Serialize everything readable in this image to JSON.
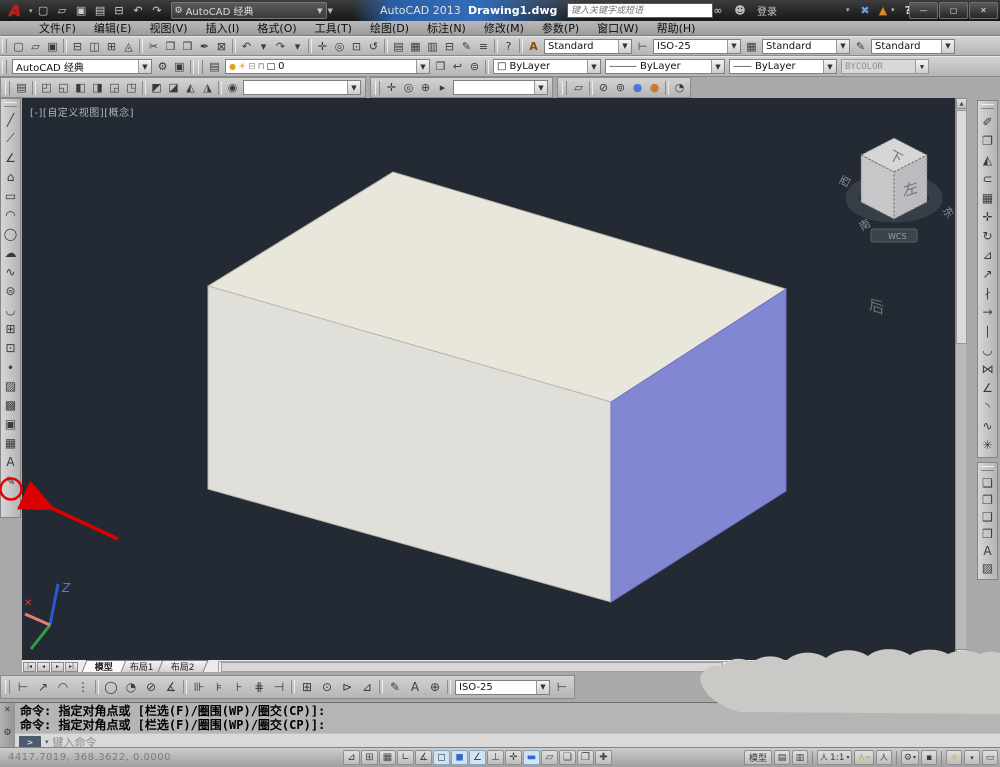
{
  "titlebar": {
    "logo_letter": "A",
    "quick_access": [
      {
        "name": "qnew-icon",
        "glyph": "▢"
      },
      {
        "name": "open-icon",
        "glyph": "▱"
      },
      {
        "name": "qsave-icon",
        "glyph": "▣"
      },
      {
        "name": "save-as-icon",
        "glyph": "▤"
      },
      {
        "name": "plot-icon",
        "glyph": "⊟"
      },
      {
        "name": "undo-icon",
        "glyph": "↶"
      },
      {
        "name": "redo-icon",
        "glyph": "↷"
      }
    ],
    "workspace_label": "AutoCAD 经典",
    "product": "AutoCAD 2013",
    "filename": "Drawing1.dwg",
    "search_placeholder": "键入关键字或短语",
    "search_icon": "∞",
    "signin_icon": "☻",
    "signin_label": "登录",
    "exchange_icon": "✖",
    "a360_icon": "▲",
    "help_icon": "?",
    "window_buttons": {
      "minimize": "—",
      "maximize": "▢",
      "close": "✕"
    }
  },
  "menubar": {
    "items": [
      {
        "name": "menu-file",
        "label": "文件(F)"
      },
      {
        "name": "menu-edit",
        "label": "编辑(E)"
      },
      {
        "name": "menu-view",
        "label": "视图(V)"
      },
      {
        "name": "menu-insert",
        "label": "插入(I)"
      },
      {
        "name": "menu-format",
        "label": "格式(O)"
      },
      {
        "name": "menu-tools",
        "label": "工具(T)"
      },
      {
        "name": "menu-draw",
        "label": "绘图(D)"
      },
      {
        "name": "menu-dimension",
        "label": "标注(N)"
      },
      {
        "name": "menu-modify",
        "label": "修改(M)"
      },
      {
        "name": "menu-parametric",
        "label": "参数(P)"
      },
      {
        "name": "menu-window",
        "label": "窗口(W)"
      },
      {
        "name": "menu-help",
        "label": "帮助(H)"
      }
    ]
  },
  "standard_toolbar": {
    "items": [
      {
        "name": "qnew-icon",
        "glyph": "▢"
      },
      {
        "name": "open-icon",
        "glyph": "▱"
      },
      {
        "name": "qsave-icon",
        "glyph": "▣"
      },
      {
        "sep": 1
      },
      {
        "name": "plot-icon",
        "glyph": "⊟"
      },
      {
        "name": "plot-preview-icon",
        "glyph": "◫"
      },
      {
        "name": "publish-icon",
        "glyph": "⊞"
      },
      {
        "name": "export-dwf-icon",
        "glyph": "◬"
      },
      {
        "sep": 1
      },
      {
        "name": "cut-icon",
        "glyph": "✂"
      },
      {
        "name": "copy-icon",
        "glyph": "❐"
      },
      {
        "name": "paste-icon",
        "glyph": "❒"
      },
      {
        "name": "match-properties-icon",
        "glyph": "✒"
      },
      {
        "name": "block-editor-icon",
        "glyph": "⊠"
      },
      {
        "sep": 1
      },
      {
        "name": "undo-icon",
        "glyph": "↶"
      },
      {
        "name": "undo-dropdown-icon",
        "glyph": "▾"
      },
      {
        "name": "redo-icon",
        "glyph": "↷"
      },
      {
        "name": "redo-dropdown-icon",
        "glyph": "▾"
      },
      {
        "sep": 1
      },
      {
        "name": "pan-icon",
        "glyph": "✛"
      },
      {
        "name": "zoom-realtime-icon",
        "glyph": "◎"
      },
      {
        "name": "zoom-window-icon",
        "glyph": "⊡"
      },
      {
        "name": "zoom-previous-icon",
        "glyph": "↺"
      },
      {
        "sep": 1
      },
      {
        "name": "properties-icon",
        "glyph": "▤"
      },
      {
        "name": "designcenter-icon",
        "glyph": "▦"
      },
      {
        "name": "tool-palettes-icon",
        "glyph": "▥"
      },
      {
        "name": "sheetset-manager-icon",
        "glyph": "⊟"
      },
      {
        "name": "markup-icon",
        "glyph": "✎"
      },
      {
        "name": "quickcalc-icon",
        "glyph": "≡"
      },
      {
        "sep": 1
      },
      {
        "name": "help-icon",
        "glyph": "?"
      }
    ],
    "text_style_icon": "A",
    "text_style": "Standard",
    "dim_style_icon": "⊢",
    "dim_style": "ISO-25",
    "table_style_icon": "▦",
    "table_style": "Standard",
    "mleader_style_icon": "✎",
    "mleader_style": "Standard"
  },
  "workspace_layers": {
    "workspace": "AutoCAD 经典",
    "gear_icon": "⚙",
    "workspace_settings_icon": "▣",
    "layer_properties_icon": "▤",
    "bulb_glyph": "●",
    "sun_glyph": "☀",
    "plot_glyph": "⊟",
    "lock_glyph": "⊓",
    "color_swatch_glyph": "□",
    "layer_name": "0",
    "tool_icons": [
      {
        "name": "make-current-layer-icon",
        "glyph": "❐"
      },
      {
        "name": "previous-layer-icon",
        "glyph": "↩"
      },
      {
        "name": "layer-states-icon",
        "glyph": "⊜"
      }
    ],
    "color_swatch": "□",
    "color": "ByLayer",
    "linetype_dash": "———",
    "linetype": "ByLayer",
    "lineweight_dash": "——",
    "lineweight": "ByLayer",
    "plot_style": "BYCOLOR"
  },
  "view_toolbar": {
    "view_items": [
      {
        "name": "named-views-icon",
        "glyph": "▤"
      },
      {
        "sep": 1
      },
      {
        "name": "top-view-icon",
        "glyph": "◰"
      },
      {
        "name": "bottom-view-icon",
        "glyph": "◱"
      },
      {
        "name": "left-view-icon",
        "glyph": "◧"
      },
      {
        "name": "right-view-icon",
        "glyph": "◨"
      },
      {
        "name": "front-view-icon",
        "glyph": "◲"
      },
      {
        "name": "back-view-icon",
        "glyph": "◳"
      },
      {
        "sep": 1
      },
      {
        "name": "sw-isometric-icon",
        "glyph": "◩"
      },
      {
        "name": "se-isometric-icon",
        "glyph": "◪"
      },
      {
        "name": "ne-isometric-icon",
        "glyph": "◭"
      },
      {
        "name": "nw-isometric-icon",
        "glyph": "◮"
      },
      {
        "sep": 1
      },
      {
        "name": "camera-icon",
        "glyph": "◉"
      }
    ],
    "view_name": "",
    "nav_items": [
      {
        "name": "3d-pan-icon",
        "glyph": "✛"
      },
      {
        "name": "3d-zoom-icon",
        "glyph": "◎"
      },
      {
        "name": "3d-orbit-icon",
        "glyph": "⊕"
      },
      {
        "name": "show-motion-icon",
        "glyph": "▸"
      }
    ],
    "nav_combo": "",
    "visual_styles": [
      {
        "name": "vs-2d-wireframe-icon",
        "glyph": "▱"
      },
      {
        "sep": 1
      },
      {
        "name": "vs-wireframe-icon",
        "glyph": "⊘"
      },
      {
        "name": "vs-hidden-icon",
        "glyph": "⊚"
      },
      {
        "name": "vs-realistic-icon",
        "glyph": "●",
        "color": "#4a76d8"
      },
      {
        "name": "vs-conceptual-icon",
        "glyph": "●",
        "color": "#d0762e"
      },
      {
        "sep": 1
      },
      {
        "name": "vs-manage-icon",
        "glyph": "◔"
      }
    ]
  },
  "draw_toolbar": {
    "items": [
      {
        "name": "line-icon",
        "glyph": "╱"
      },
      {
        "name": "construction-line-icon",
        "glyph": "⟋"
      },
      {
        "name": "polyline-icon",
        "glyph": "∠"
      },
      {
        "name": "polygon-icon",
        "glyph": "⌂"
      },
      {
        "name": "rectangle-icon",
        "glyph": "▭"
      },
      {
        "name": "arc-icon",
        "glyph": "◠"
      },
      {
        "name": "circle-icon",
        "glyph": "◯"
      },
      {
        "name": "revision-cloud-icon",
        "glyph": "☁"
      },
      {
        "name": "spline-icon",
        "glyph": "∿"
      },
      {
        "name": "ellipse-icon",
        "glyph": "⊜"
      },
      {
        "name": "ellipse-arc-icon",
        "glyph": "◡"
      },
      {
        "name": "insert-block-icon",
        "glyph": "⊞"
      },
      {
        "name": "make-block-icon",
        "glyph": "⊡"
      },
      {
        "name": "point-icon",
        "glyph": "∙"
      },
      {
        "name": "hatch-icon",
        "glyph": "▨"
      },
      {
        "name": "gradient-icon",
        "glyph": "▩"
      },
      {
        "name": "region-icon",
        "glyph": "▣"
      },
      {
        "name": "table-icon",
        "glyph": "▦"
      },
      {
        "name": "multiline-text-icon",
        "glyph": "A"
      },
      {
        "name": "add-selected-icon",
        "glyph": "✎"
      }
    ]
  },
  "modify_toolbar": {
    "items": [
      {
        "name": "erase-icon",
        "glyph": "✐"
      },
      {
        "name": "copy-icon",
        "glyph": "❐"
      },
      {
        "name": "mirror-icon",
        "glyph": "◭"
      },
      {
        "name": "offset-icon",
        "glyph": "⊂"
      },
      {
        "name": "array-icon",
        "glyph": "▦"
      },
      {
        "name": "move-icon",
        "glyph": "✛"
      },
      {
        "name": "rotate-icon",
        "glyph": "↻"
      },
      {
        "name": "scale-icon",
        "glyph": "⊿"
      },
      {
        "name": "stretch-icon",
        "glyph": "↗"
      },
      {
        "name": "trim-icon",
        "glyph": "∤"
      },
      {
        "name": "extend-icon",
        "glyph": "→"
      },
      {
        "name": "break-at-point-icon",
        "glyph": "∣"
      },
      {
        "name": "break-icon",
        "glyph": "◡"
      },
      {
        "name": "join-icon",
        "glyph": "⋈"
      },
      {
        "name": "chamfer-icon",
        "glyph": "∠"
      },
      {
        "name": "fillet-icon",
        "glyph": "◝"
      },
      {
        "name": "blend-curves-icon",
        "glyph": "∿"
      },
      {
        "name": "explode-icon",
        "glyph": "✳"
      }
    ]
  },
  "draworder_toolbar": {
    "items": [
      {
        "name": "bring-to-front-icon",
        "glyph": "❏"
      },
      {
        "name": "send-to-back-icon",
        "glyph": "❐"
      },
      {
        "name": "bring-above-icon",
        "glyph": "❑"
      },
      {
        "name": "send-under-icon",
        "glyph": "❒"
      },
      {
        "name": "text-to-front-icon",
        "glyph": "A"
      },
      {
        "name": "hatch-to-back-icon",
        "glyph": "▨"
      }
    ]
  },
  "viewport": {
    "label": "[-][自定义视图][概念]",
    "viewcube": {
      "front_face": "后",
      "right_face": "左",
      "top_face": "下",
      "compass_west": "西",
      "compass_south": "南",
      "compass_east": "东",
      "wcs_label": "WCS"
    },
    "ucs": {
      "z_label": "Z",
      "x_mark": "✕"
    }
  },
  "scene": {
    "box": {
      "top_color": "#e9e7dc",
      "front_color": "#e0dfda",
      "right_color": "#8287d4"
    }
  },
  "tabs": {
    "nav": [
      {
        "name": "tab-first-icon",
        "glyph": "|◂"
      },
      {
        "name": "tab-prev-icon",
        "glyph": "◂"
      },
      {
        "name": "tab-next-icon",
        "glyph": "▸"
      },
      {
        "name": "tab-last-icon",
        "glyph": "▸|"
      }
    ],
    "items": [
      {
        "name": "tab-model",
        "label": "模型",
        "on": true
      },
      {
        "name": "tab-layout1",
        "label": "布局1"
      },
      {
        "name": "tab-layout2",
        "label": "布局2"
      }
    ]
  },
  "dim_toolbar": {
    "items": [
      {
        "name": "dim-linear-icon",
        "glyph": "⊢"
      },
      {
        "name": "dim-aligned-icon",
        "glyph": "↗"
      },
      {
        "name": "dim-arc-length-icon",
        "glyph": "◠"
      },
      {
        "name": "dim-ordinate-icon",
        "glyph": "⋮"
      },
      {
        "sep": 1
      },
      {
        "name": "dim-radius-icon",
        "glyph": "◯"
      },
      {
        "name": "dim-jogged-icon",
        "glyph": "◔"
      },
      {
        "name": "dim-diameter-icon",
        "glyph": "⊘"
      },
      {
        "name": "dim-angular-icon",
        "glyph": "∡"
      },
      {
        "sep": 1
      },
      {
        "name": "quick-dimension-icon",
        "glyph": "⊪"
      },
      {
        "name": "dim-baseline-icon",
        "glyph": "⊧"
      },
      {
        "name": "dim-continue-icon",
        "glyph": "⊦"
      },
      {
        "name": "dim-space-icon",
        "glyph": "⋕"
      },
      {
        "name": "dim-break-icon",
        "glyph": "⊣"
      },
      {
        "sep": 1
      },
      {
        "name": "tolerance-icon",
        "glyph": "⊞"
      },
      {
        "name": "center-mark-icon",
        "glyph": "⊙"
      },
      {
        "name": "dim-inspect-icon",
        "glyph": "⊳"
      },
      {
        "name": "dim-jogged-linear-icon",
        "glyph": "⊿"
      },
      {
        "sep": 1
      },
      {
        "name": "dim-edit-icon",
        "glyph": "✎"
      },
      {
        "name": "dim-text-edit-icon",
        "glyph": "A"
      },
      {
        "name": "dim-update-icon",
        "glyph": "⊕"
      }
    ],
    "style": "ISO-25",
    "style_icon": "⊢"
  },
  "command": {
    "close_icon": "✕",
    "tools_icon": "⚙",
    "history": [
      "命令: 指定对角点或 [栏选(F)/圈围(WP)/圈交(CP)]:",
      "命令: 指定对角点或 [栏选(F)/圈围(WP)/圈交(CP)]:"
    ],
    "prompt_glyph": ">",
    "dropdown_glyph": "▾",
    "placeholder": "键入命令"
  },
  "statusbar": {
    "coords": "4417.7019, 368.3622, 0.0000",
    "toggles": [
      {
        "name": "infer-constraints-toggle",
        "glyph": "⊿"
      },
      {
        "name": "snap-mode-toggle",
        "glyph": "⊞"
      },
      {
        "name": "grid-display-toggle",
        "glyph": "▦"
      },
      {
        "name": "ortho-mode-toggle",
        "glyph": "∟"
      },
      {
        "name": "polar-tracking-toggle",
        "glyph": "∡"
      },
      {
        "name": "object-snap-toggle",
        "glyph": "◻",
        "on": true
      },
      {
        "name": "3d-object-snap-toggle",
        "glyph": "◼",
        "on": true,
        "color": "#3b66c8"
      },
      {
        "name": "object-snap-tracking-toggle",
        "glyph": "∠",
        "on": true
      },
      {
        "name": "dynamic-ucs-toggle",
        "glyph": "⊥"
      },
      {
        "name": "dynamic-input-toggle",
        "glyph": "✛"
      },
      {
        "name": "lineweight-toggle",
        "glyph": "▬",
        "on": true,
        "color": "#3b66c8"
      },
      {
        "name": "transparency-toggle",
        "glyph": "▱"
      },
      {
        "name": "quick-properties-toggle",
        "glyph": "❏"
      },
      {
        "name": "selection-cycling-toggle",
        "glyph": "❐"
      },
      {
        "name": "annotation-monitor-toggle",
        "glyph": "✚"
      }
    ],
    "model_label": "模型",
    "layout_icon": "▤",
    "quickview-layouts_icon": "▥",
    "person_glyph": "人",
    "annotation_scale": "1:1",
    "scale_arrow": "▾",
    "annotation_visibility_icon": "⌁",
    "autoscale_icon": "人",
    "workspace_gear_icon": "⚙",
    "workspace_lock_icon": "▪",
    "isolate_icon": "☼",
    "status_menu_arrow": "▾",
    "clean_screen_icon": "▭"
  }
}
